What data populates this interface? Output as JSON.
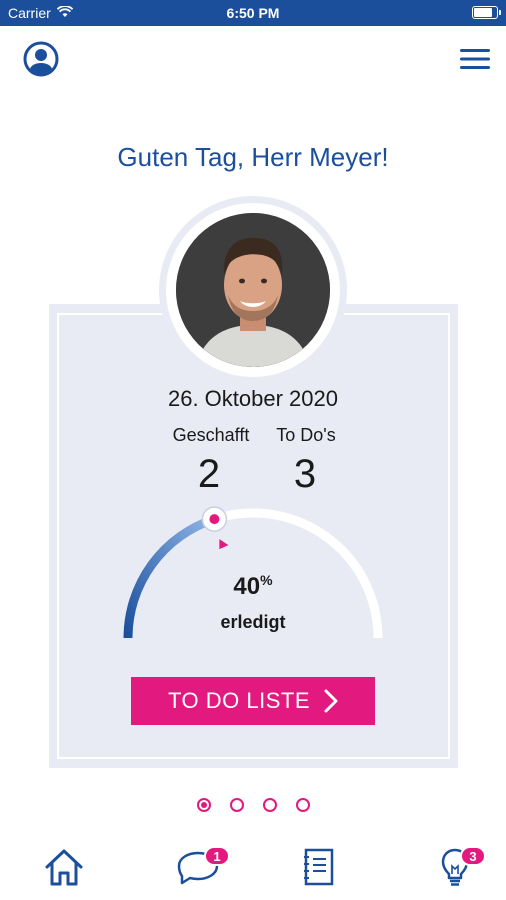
{
  "status_bar": {
    "carrier": "Carrier",
    "time": "6:50 PM",
    "battery_level": 0.85
  },
  "header": {
    "greeting": "Guten Tag, Herr Meyer!"
  },
  "profile_card": {
    "date": "26. Oktober 2020",
    "done_label": "Geschafft",
    "done_value": "2",
    "todo_label": "To Do's",
    "todo_value": "3",
    "progress_value": "40",
    "progress_unit": "%",
    "progress_fraction": 0.4,
    "progress_label": "erledigt",
    "todo_button_label": "TO DO LISTE"
  },
  "pager": {
    "pages": 4,
    "active_index": 0
  },
  "tab_bar": {
    "items": [
      {
        "icon": "home-icon"
      },
      {
        "icon": "chat-icon",
        "badge": "1"
      },
      {
        "icon": "notebook-icon"
      },
      {
        "icon": "lightbulb-icon",
        "badge": "3"
      }
    ]
  },
  "colors": {
    "brand_blue": "#1b4f9c",
    "accent_pink": "#e2197e",
    "card_bg": "#e8ebf4"
  }
}
